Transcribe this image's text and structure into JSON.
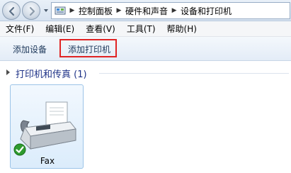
{
  "breadcrumbs": [
    "控制面板",
    "硬件和声音",
    "设备和打印机"
  ],
  "menu": [
    "文件(F)",
    "编辑(E)",
    "查看(V)",
    "工具(T)",
    "帮助(H)"
  ],
  "commands": {
    "add_device": "添加设备",
    "add_printer": "添加打印机"
  },
  "group": {
    "title": "打印机和传真 (1)"
  },
  "devices": [
    {
      "name": "Fax",
      "icon": "fax-icon",
      "status_icon": "default-checkmark-icon"
    }
  ],
  "colors": {
    "highlight_border": "#e02424",
    "group_title": "#1e3287",
    "tile_border": "#9cc4e8"
  }
}
